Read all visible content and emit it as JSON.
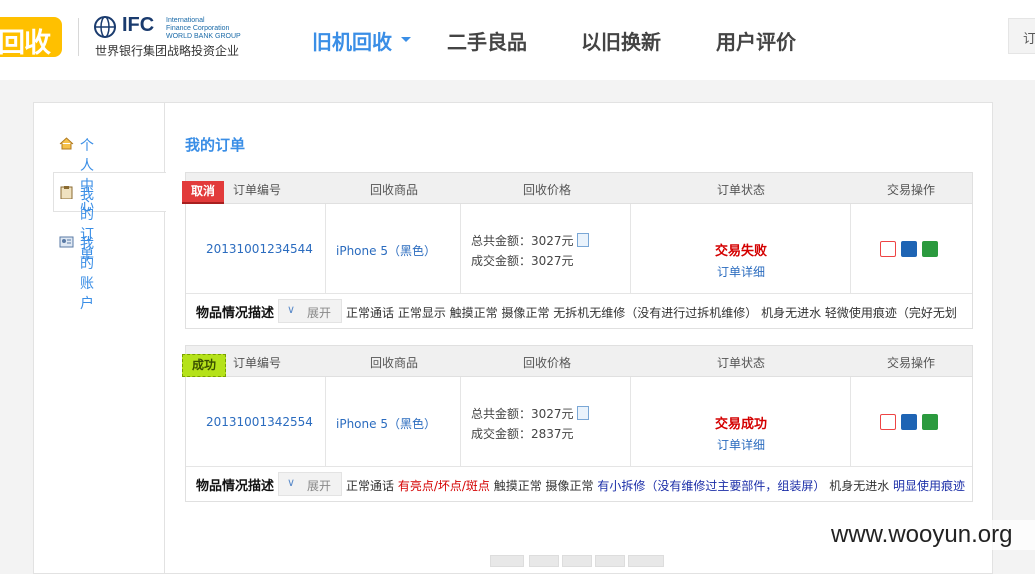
{
  "header": {
    "logo_text": "回收",
    "ifc_name": "IFC",
    "ifc_full": [
      "International",
      "Finance Corporation",
      "WORLD BANK GROUP"
    ],
    "ifc_tagline": "世界银行集团战略投资企业",
    "nav": [
      {
        "label": "旧机回收",
        "active": true
      },
      {
        "label": "二手良品",
        "active": false
      },
      {
        "label": "以旧换新",
        "active": false
      },
      {
        "label": "用户评价",
        "active": false
      }
    ],
    "right_button": "订"
  },
  "sidebar": {
    "items": [
      {
        "label": "个人中心",
        "icon": "home-icon"
      },
      {
        "label": "我的订单",
        "icon": "clipboard-icon",
        "active": true
      },
      {
        "label": "我的账户",
        "icon": "id-card-icon"
      }
    ]
  },
  "main": {
    "title": "我的订单",
    "columns": [
      "订单编号",
      "回收商品",
      "回收价格",
      "订单状态",
      "交易操作"
    ],
    "orders": [
      {
        "tag": "取消",
        "tag_color": "#e23b3b",
        "order_id": "20131001234544",
        "product": "iPhone 5（黑色）",
        "total": "总共金额：3027元",
        "deal": "成交金额：3027元",
        "status": "交易失败",
        "detail_link": "订单详细",
        "desc_label": "物品情况描述",
        "expand_label": "展开",
        "desc_parts": [
          "正常通话 正常显示 触摸正常 摄像正常 无拆机无维修（没有进行过拆机维修） 机身无进水 轻微使用痕迹（完好无划"
        ]
      },
      {
        "tag": "成功",
        "tag_color": "#b5e21a",
        "order_id": "20131001342554",
        "product": "iPhone 5（黑色）",
        "total": "总共金额：3027元",
        "deal": "成交金额：2837元",
        "status": "交易成功",
        "detail_link": "订单详细",
        "desc_label": "物品情况描述",
        "expand_label": "展开",
        "desc_parts": [
          "正常通话 ",
          "有亮点/坏点/斑点",
          " 触摸正常 摄像正常 ",
          "有小拆修（没有维修过主要部件，组装屏）",
          " 机身无进水 ",
          "明显使用痕迹"
        ]
      }
    ]
  },
  "watermark": "www.wooyun.org"
}
